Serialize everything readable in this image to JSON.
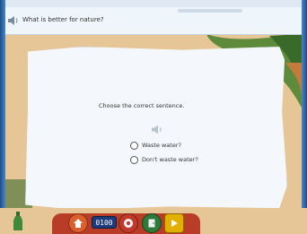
{
  "header": {
    "question": "What is better for nature?"
  },
  "exercise": {
    "instruction": "Choose the correct sentence.",
    "options": [
      {
        "label": "Waste water?"
      },
      {
        "label": "Don't waste water?"
      }
    ]
  },
  "toolbar": {
    "score": "0100"
  },
  "colors": {
    "frame_blue": "#2f66a7",
    "paper": "#f4f8fc",
    "background_sand": "#e6c596",
    "toolbar_red": "#b93c26"
  }
}
